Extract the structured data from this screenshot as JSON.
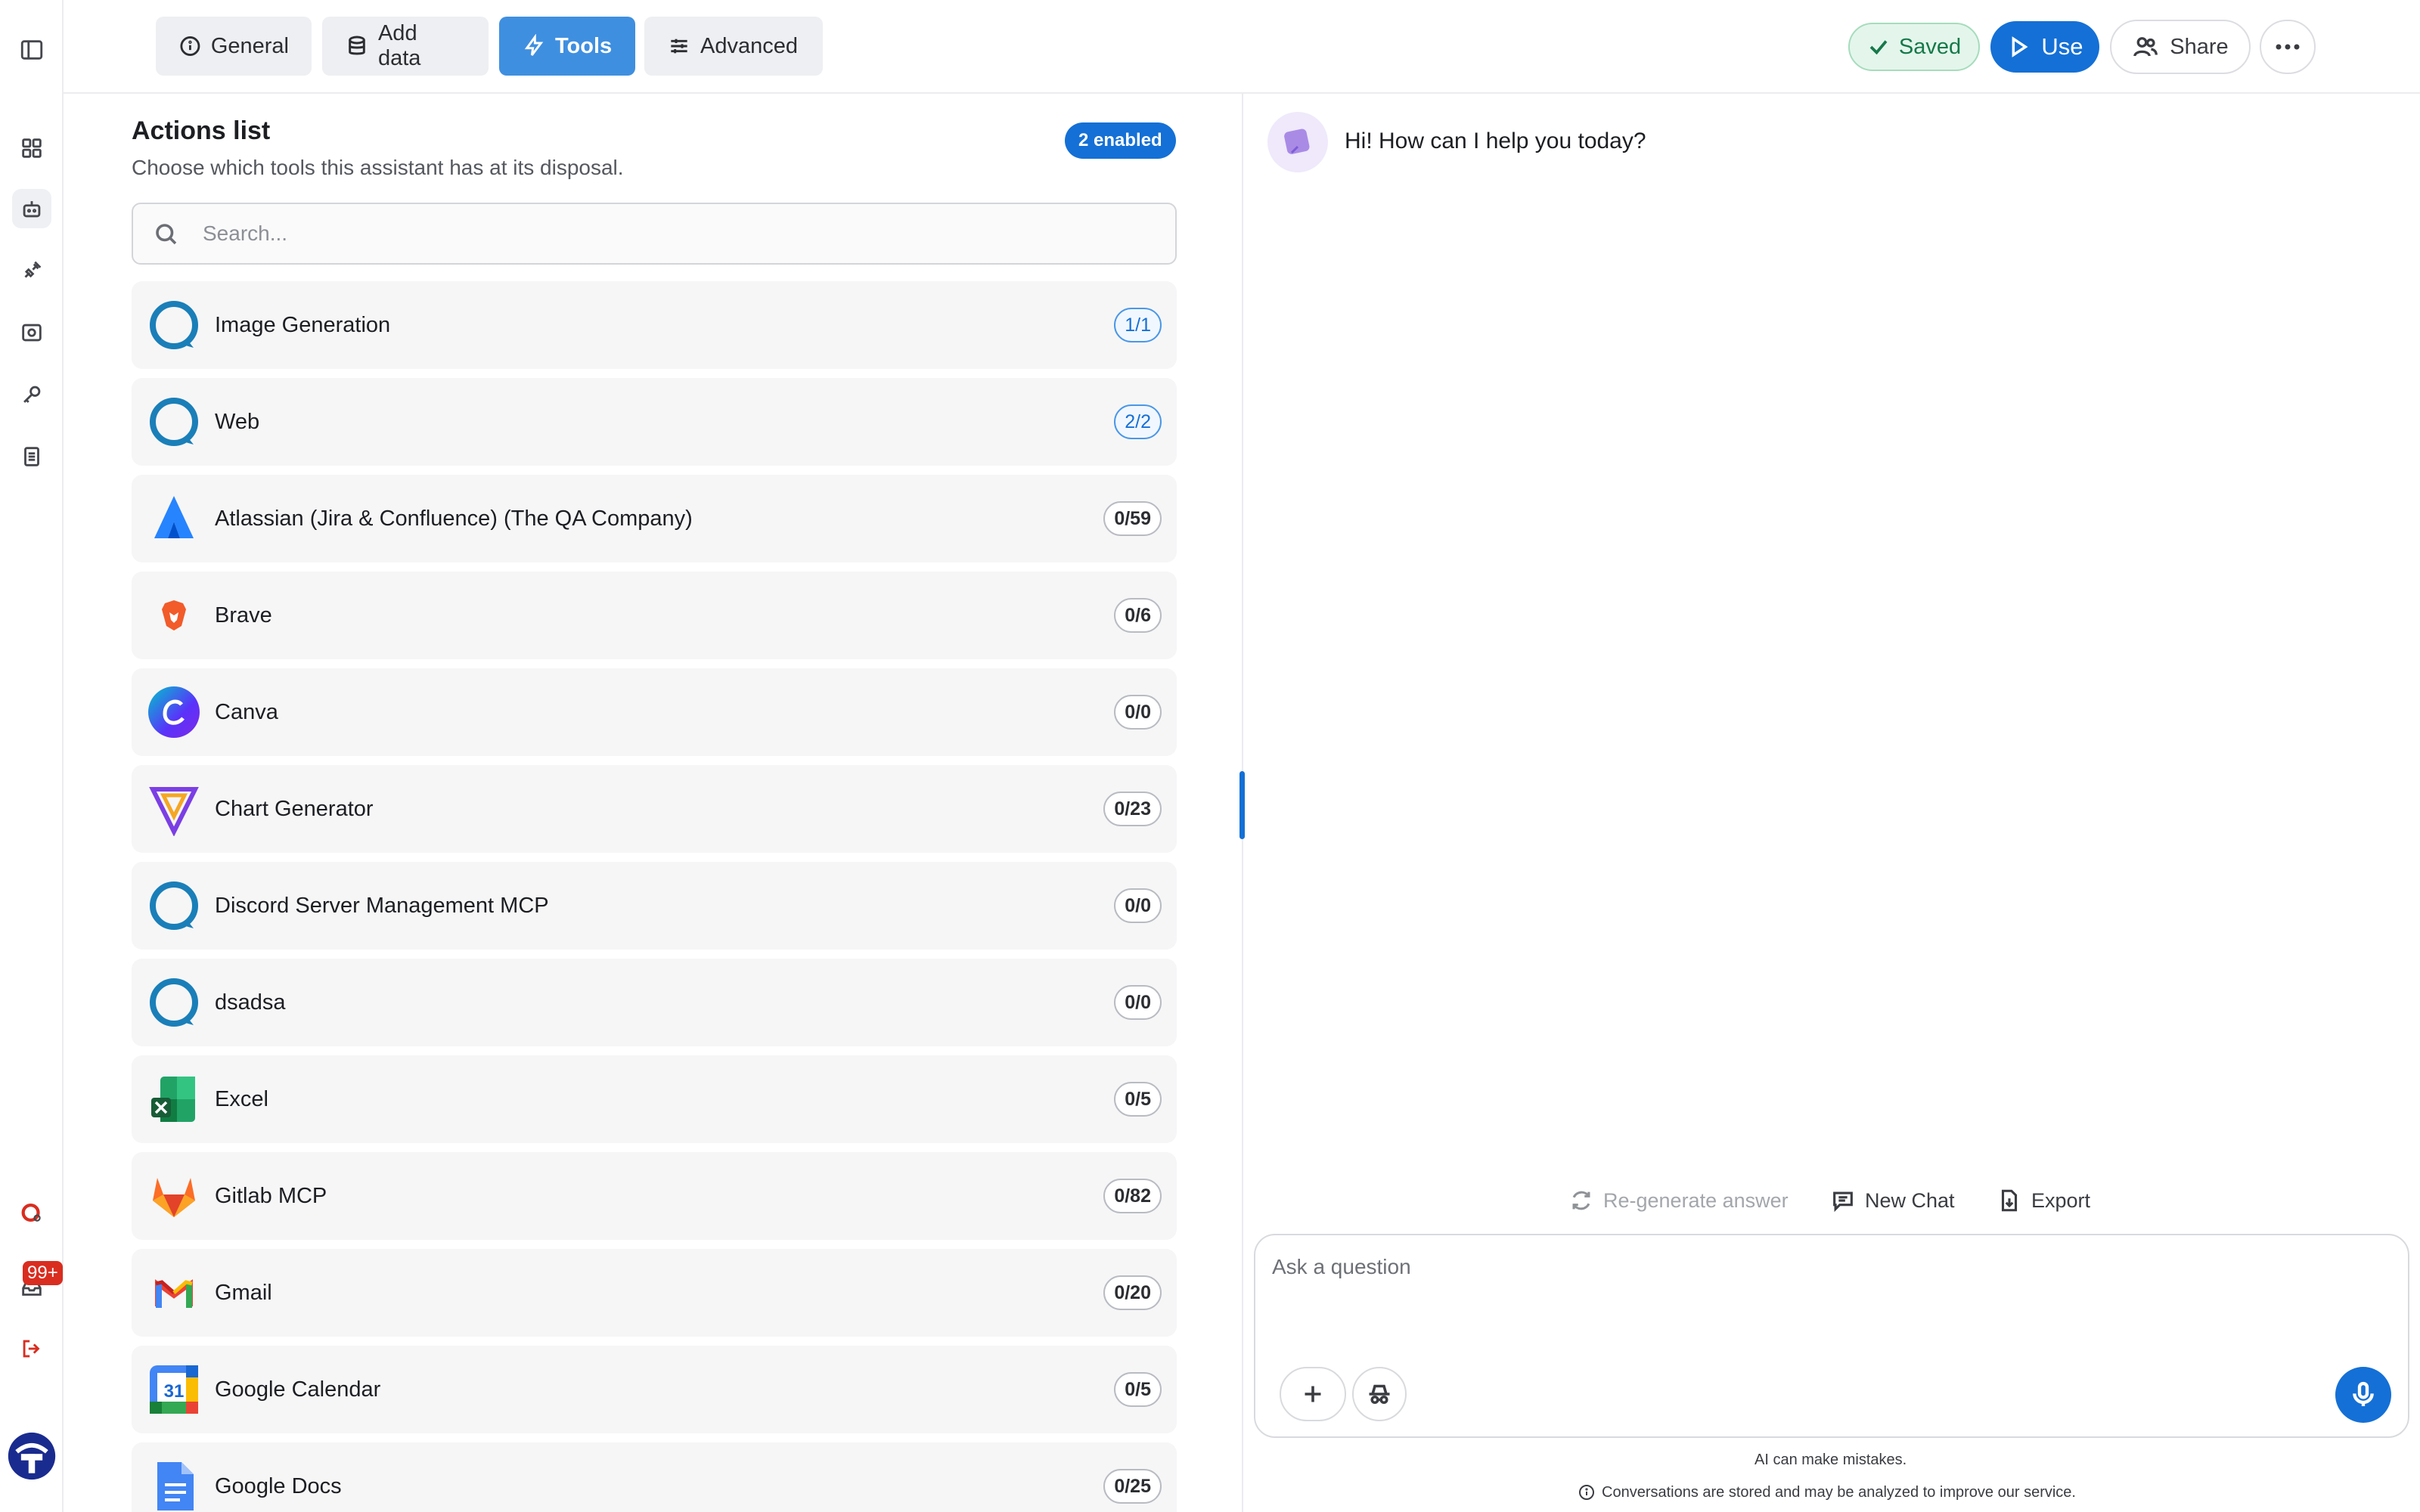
{
  "topbar": {
    "tabs": [
      {
        "label": "General",
        "icon": "info-icon"
      },
      {
        "label": "Add data",
        "icon": "database-icon"
      },
      {
        "label": "Tools",
        "icon": "lightning-icon",
        "active": true
      },
      {
        "label": "Advanced",
        "icon": "sliders-icon"
      }
    ],
    "saved_label": "Saved",
    "use_label": "Use",
    "share_label": "Share"
  },
  "rail": {
    "items": [
      "sidebar-toggle-icon",
      "apps-grid-icon",
      "assistant-bot-icon",
      "plug-icon",
      "screen-capture-icon",
      "key-icon",
      "document-icon"
    ],
    "notification_count": "99+"
  },
  "actions": {
    "title": "Actions list",
    "subtitle": "Choose which tools this assistant has at its disposal.",
    "enabled_badge": "2 enabled",
    "search_placeholder": "Search...",
    "tools": [
      {
        "name": "Image Generation",
        "count": "1/1",
        "enabled": true,
        "icon": "qa-ring-icon"
      },
      {
        "name": "Web",
        "count": "2/2",
        "enabled": true,
        "icon": "qa-ring-icon"
      },
      {
        "name": "Atlassian (Jira & Confluence) (The QA Company)",
        "count": "0/59",
        "enabled": false,
        "icon": "atlassian-logo-icon"
      },
      {
        "name": "Brave",
        "count": "0/6",
        "enabled": false,
        "icon": "brave-logo-icon"
      },
      {
        "name": "Canva",
        "count": "0/0",
        "enabled": false,
        "icon": "canva-logo-icon"
      },
      {
        "name": "Chart Generator",
        "count": "0/23",
        "enabled": false,
        "icon": "chart-generator-logo-icon"
      },
      {
        "name": "Discord Server Management MCP",
        "count": "0/0",
        "enabled": false,
        "icon": "qa-ring-icon"
      },
      {
        "name": "dsadsa",
        "count": "0/0",
        "enabled": false,
        "icon": "qa-ring-icon"
      },
      {
        "name": "Excel",
        "count": "0/5",
        "enabled": false,
        "icon": "excel-logo-icon"
      },
      {
        "name": "Gitlab MCP",
        "count": "0/82",
        "enabled": false,
        "icon": "gitlab-logo-icon"
      },
      {
        "name": "Gmail",
        "count": "0/20",
        "enabled": false,
        "icon": "gmail-logo-icon"
      },
      {
        "name": "Google Calendar",
        "count": "0/5",
        "enabled": false,
        "icon": "google-calendar-logo-icon"
      },
      {
        "name": "Google Docs",
        "count": "0/25",
        "enabled": false,
        "icon": "google-docs-logo-icon"
      }
    ]
  },
  "chat": {
    "greeting": "Hi! How can I help you today?",
    "regenerate_label": "Re-generate answer",
    "new_chat_label": "New Chat",
    "export_label": "Export",
    "input_placeholder": "Ask a question",
    "disclaimer": "AI can make mistakes.",
    "storage_notice": "Conversations are stored and may be analyzed to improve our service."
  },
  "colors": {
    "accent": "#1470d6",
    "tab_active": "#3f8fe0",
    "saved_green": "#16794a",
    "badge_red": "#d92d20"
  }
}
